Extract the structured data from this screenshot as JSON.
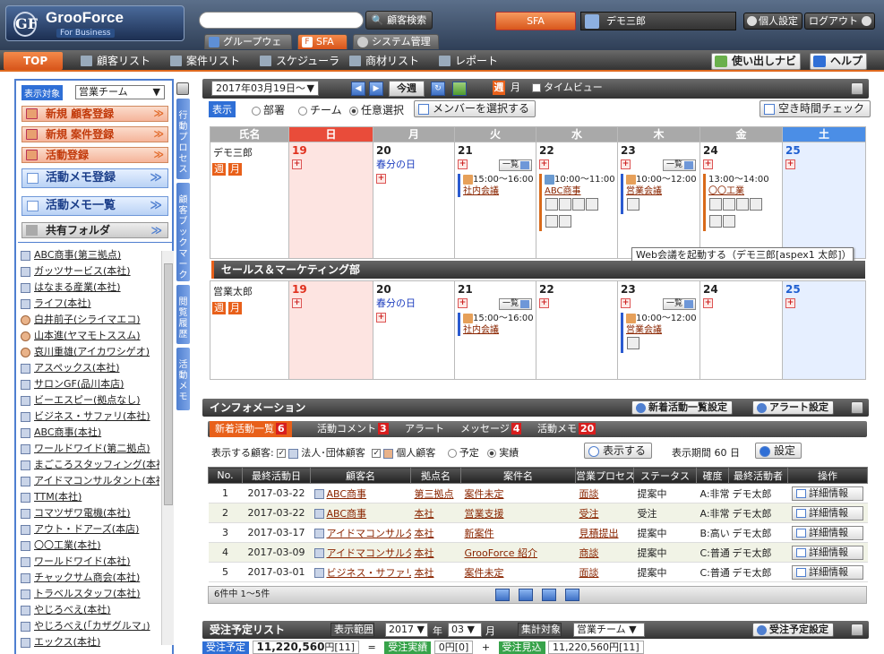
{
  "header": {
    "logo_name": "GrooForce",
    "logo_sub": "For Business",
    "logo_mark": "GF",
    "search_placeholder": "",
    "search_btn": "顧客検索",
    "tabs": [
      "グループウェア",
      "SFA",
      "システム管理"
    ],
    "sfa_label": "SFA",
    "user_name": "デモ三郎",
    "personal_settings": "個人設定",
    "logout": "ログアウト"
  },
  "nav": {
    "top": "TOP",
    "items": [
      "顧客リスト",
      "案件リスト",
      "スケジューラ",
      "商材リスト",
      "レポート"
    ],
    "guide": "使い出しナビ",
    "help": "ヘルプ"
  },
  "left": {
    "target_label": "表示対象",
    "target_value": "営業チーム",
    "buttons": [
      "新規 顧客登録",
      "新規 案件登録",
      "活動登録"
    ],
    "big_buttons": [
      "活動メモ登録",
      "活動メモ一覧"
    ],
    "shared": "共有フォルダ",
    "customers": [
      {
        "name": "ABC商事(第三拠点)",
        "type": "corp"
      },
      {
        "name": "ガッツサービス(本社)",
        "type": "corp"
      },
      {
        "name": "はなまる産業(本社)",
        "type": "corp"
      },
      {
        "name": "ライフ(本社)",
        "type": "corp"
      },
      {
        "name": "白井前子(シライマエコ)",
        "type": "person"
      },
      {
        "name": "山本進(ヤマモトススム)",
        "type": "person"
      },
      {
        "name": "哀川重雄(アイカワシゲオ)",
        "type": "person"
      },
      {
        "name": "アスペックス(本社)",
        "type": "corp"
      },
      {
        "name": "サロンGF(品川本店)",
        "type": "corp"
      },
      {
        "name": "ビーエスピー(拠点なし)",
        "type": "corp"
      },
      {
        "name": "ビジネス・サファリ(本社)",
        "type": "corp"
      },
      {
        "name": "ABC商事(本社)",
        "type": "corp"
      },
      {
        "name": "ワールドワイド(第二拠点)",
        "type": "corp"
      },
      {
        "name": "まごころスタッフィング(本社)",
        "type": "corp"
      },
      {
        "name": "アイドマコンサルタント(本社)",
        "type": "corp"
      },
      {
        "name": "TTM(本社)",
        "type": "corp"
      },
      {
        "name": "コマツザワ電機(本社)",
        "type": "corp"
      },
      {
        "name": "アウト・ドアーズ(本店)",
        "type": "corp"
      },
      {
        "name": "〇〇工業(本社)",
        "type": "corp"
      },
      {
        "name": "ワールドワイド(本社)",
        "type": "corp"
      },
      {
        "name": "チャックサム商会(本社)",
        "type": "corp"
      },
      {
        "name": "トラベルスタッフ(本社)",
        "type": "corp"
      },
      {
        "name": "やじろべえ(本社)",
        "type": "corp"
      },
      {
        "name": "やじろべえ(「カザグルマ」)",
        "type": "corp"
      },
      {
        "name": "エックス(本社)",
        "type": "corp"
      }
    ],
    "vtabs": [
      "行動プロセス",
      "顧客ブックマーク",
      "閲覧履歴",
      "活動メモ"
    ]
  },
  "calendar": {
    "date": "2017年03月19日～",
    "today": "今週",
    "week": "週",
    "month": "月",
    "timeview": "タイムビュー",
    "display_label": "表示",
    "opt_dept": "部署",
    "opt_team": "チーム",
    "opt_any": "任意選択",
    "member_btn": "メンバーを選択する",
    "free_check": "空き時間チェック",
    "headers": [
      "氏名",
      "日",
      "月",
      "火",
      "水",
      "木",
      "金",
      "土"
    ],
    "days": [
      "19",
      "20",
      "21",
      "22",
      "23",
      "24",
      "25"
    ],
    "holiday": "春分の日",
    "list_btn": "一覧",
    "rows": [
      {
        "name": "デモ三郎",
        "events": {
          "tue": {
            "time": "15:00～16:00",
            "title": "社内会議"
          },
          "wed": {
            "time": "10:00～11:00",
            "title": "ABC商事"
          },
          "thu": {
            "time": "10:00～12:00",
            "title": "営業会議"
          },
          "fri": {
            "time": "13:00～14:00",
            "title": "〇〇工業"
          }
        }
      },
      {
        "name": "営業太郎",
        "events": {
          "tue": {
            "time": "15:00～16:00",
            "title": "社内会議"
          },
          "thu": {
            "time": "10:00～12:00",
            "title": "営業会議"
          }
        }
      }
    ],
    "dept": "セールス＆マーケティング部",
    "tooltip": "Web会議を起動する（デモ三郎[aspex1 太郎]）"
  },
  "info": {
    "title": "インフォメーション",
    "btn_new": "新着活動一覧設定",
    "btn_alert": "アラート設定",
    "tabs": [
      {
        "label": "新着活動一覧",
        "count": "6"
      },
      {
        "label": "活動コメント",
        "count": "3"
      },
      {
        "label": "アラート",
        "count": ""
      },
      {
        "label": "メッセージ",
        "count": "4"
      },
      {
        "label": "活動メモ",
        "count": "20"
      }
    ],
    "filter_label": "表示する顧客:",
    "corp": "法人･団体顧客",
    "person": "個人顧客",
    "plan": "予定",
    "actual": "実績",
    "show": "表示する",
    "period": "表示期間",
    "period_val": "60 日",
    "settings": "設定",
    "columns": [
      "No.",
      "最終活動日",
      "顧客名",
      "拠点名",
      "案件名",
      "営業プロセス",
      "ステータス",
      "確度",
      "最終活動者",
      "操作"
    ],
    "rows": [
      {
        "no": "1",
        "date": "2017-03-22",
        "cust": "ABC商事",
        "site": "第三拠点",
        "deal": "案件未定",
        "proc": "面談",
        "status": "提案中",
        "prob": "A:非常に高い",
        "user": "デモ太郎"
      },
      {
        "no": "2",
        "date": "2017-03-22",
        "cust": "ABC商事",
        "site": "本社",
        "deal": "営業支援",
        "proc": "受注",
        "status": "受注",
        "prob": "A:非常に高い",
        "user": "デモ太郎"
      },
      {
        "no": "3",
        "date": "2017-03-17",
        "cust": "アイドマコンサルタント",
        "site": "本社",
        "deal": "新案件",
        "proc": "見積提出",
        "status": "提案中",
        "prob": "B:高い",
        "user": "デモ太郎"
      },
      {
        "no": "4",
        "date": "2017-03-09",
        "cust": "アイドマコンサルタント",
        "site": "本社",
        "deal": "GrooForce 紹介",
        "proc": "商談",
        "status": "提案中",
        "prob": "C:普通",
        "user": "デモ太郎"
      },
      {
        "no": "5",
        "date": "2017-03-01",
        "cust": "ビジネス・サファリ",
        "site": "本社",
        "deal": "案件未定",
        "proc": "面談",
        "status": "提案中",
        "prob": "C:普通",
        "user": "デモ太郎"
      }
    ],
    "detail": "詳細情報",
    "pager": "6件中 1～5件"
  },
  "orders": {
    "title": "受注予定リスト",
    "range": "表示範囲",
    "year": "2017",
    "year_unit": "年",
    "month": "03",
    "month_unit": "月",
    "target": "集計対象",
    "team": "営業チーム",
    "settings": "受注予定設定",
    "plan_label": "受注予定",
    "plan_val": "11,220,560",
    "plan_cnt": "円[11]",
    "eq": "=",
    "actual_label": "受注実績",
    "actual_val": "0円[0]",
    "plus": "+",
    "exp_label": "受注見込",
    "exp_val": "11,220,560円[11]"
  }
}
